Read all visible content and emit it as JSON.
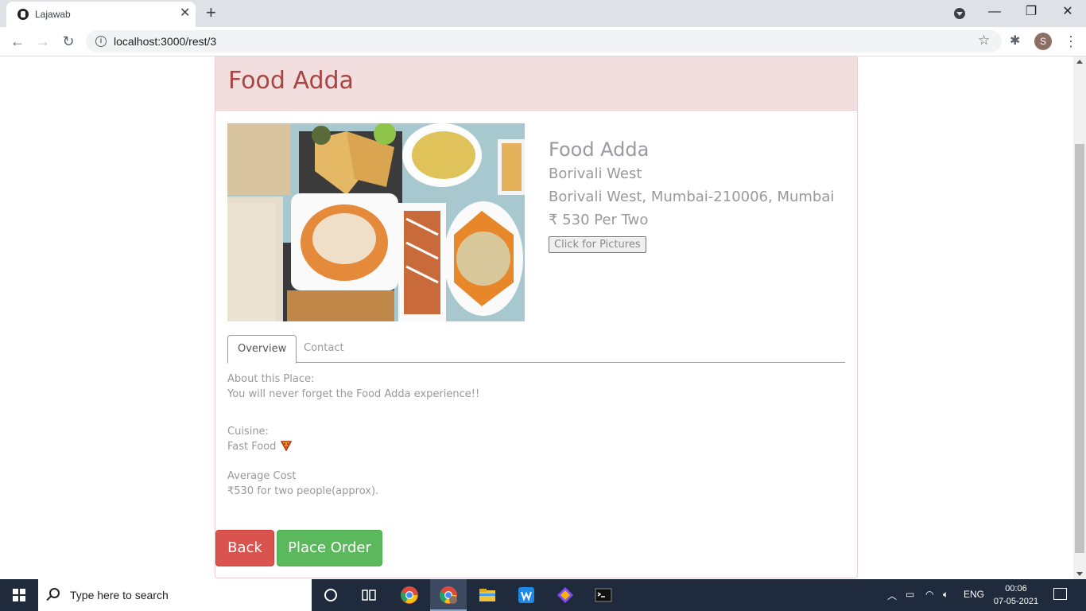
{
  "browser": {
    "tab_title": "Lajawab",
    "url": "localhost:3000/rest/3",
    "avatar_letter": "S"
  },
  "page": {
    "panel_title": "Food Adda",
    "restaurant": {
      "name": "Food Adda",
      "locality": "Borivali West",
      "address": "Borivali West, Mumbai-210006, Mumbai",
      "cost": "₹ 530 Per Two",
      "pictures_button": "Click for Pictures"
    },
    "tabs": [
      {
        "label": "Overview",
        "active": true
      },
      {
        "label": "Contact",
        "active": false
      }
    ],
    "overview": {
      "about_heading": "About this Place:",
      "about_text": "You will never forget the Food Adda experience!!",
      "cuisine_heading": "Cuisine:",
      "cuisine_text": "Fast Food",
      "avg_heading": "Average Cost",
      "avg_text": "₹530 for two people(approx)."
    },
    "buttons": {
      "back": "Back",
      "place_order": "Place Order"
    }
  },
  "taskbar": {
    "search_placeholder": "Type here to search",
    "language": "ENG",
    "time": "00:06",
    "date": "07-05-2021"
  }
}
